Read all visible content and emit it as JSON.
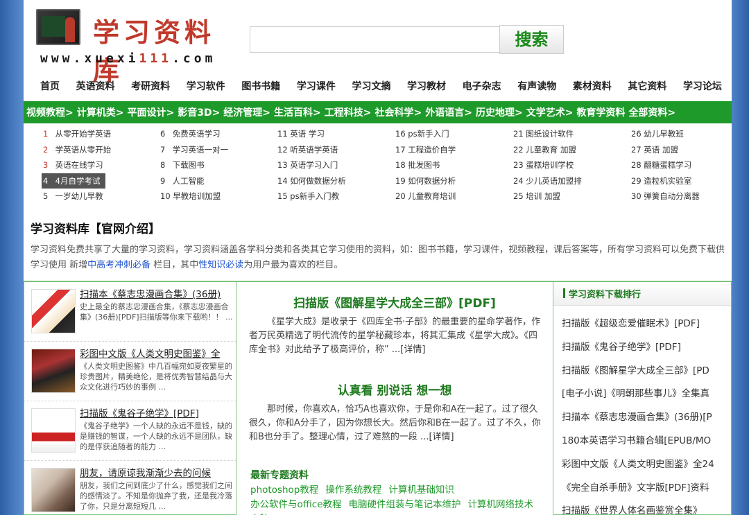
{
  "header": {
    "logo_title": "学习资料库",
    "logo_url_prefix": "www.xuexi",
    "logo_url_number": "111",
    "logo_url_suffix": ".com",
    "search_placeholder": "",
    "search_button": "搜索"
  },
  "nav_main": [
    "首页",
    "英语资料",
    "考研资料",
    "学习软件",
    "图书书籍",
    "学习课件",
    "学习文摘",
    "学习教材",
    "电子杂志",
    "有声读物",
    "素材资料",
    "其它资料",
    "学习论坛"
  ],
  "nav_categories": [
    "视频教程>",
    "计算机类>",
    "平面设计>",
    "影音3D>",
    "经济管理>",
    "生活百科>",
    "工程科技>",
    "社会科学>",
    "外语语言>",
    "历史地理>",
    "文学艺术>",
    "教育学资料",
    "全部资料>"
  ],
  "keywords": [
    [
      {
        "n": "1",
        "t": "从零开始学英语"
      },
      {
        "n": "2",
        "t": "学英语从零开始"
      },
      {
        "n": "3",
        "t": "英语在线学习"
      },
      {
        "n": "4",
        "t": "4月自学考试"
      },
      {
        "n": "5",
        "t": "一岁幼儿早教"
      }
    ],
    [
      {
        "n": "6",
        "t": "免费英语学习"
      },
      {
        "n": "7",
        "t": "学习英语一对一"
      },
      {
        "n": "8",
        "t": "下载图书"
      },
      {
        "n": "9",
        "t": "人工智能"
      },
      {
        "n": "10",
        "t": "早教培训加盟"
      }
    ],
    [
      {
        "n": "11",
        "t": "英语 学习"
      },
      {
        "n": "12",
        "t": "听英语学英语"
      },
      {
        "n": "13",
        "t": "英语学习入门"
      },
      {
        "n": "14",
        "t": "如何做数据分析"
      },
      {
        "n": "15",
        "t": "ps新手入门教"
      }
    ],
    [
      {
        "n": "16",
        "t": "ps新手入门"
      },
      {
        "n": "17",
        "t": "工程造价自学"
      },
      {
        "n": "18",
        "t": "批发图书"
      },
      {
        "n": "19",
        "t": "如何数据分析"
      },
      {
        "n": "20",
        "t": "儿童教育培训"
      }
    ],
    [
      {
        "n": "21",
        "t": "图纸设计软件"
      },
      {
        "n": "22",
        "t": "儿童教育 加盟"
      },
      {
        "n": "23",
        "t": "蛋糕培训学校"
      },
      {
        "n": "24",
        "t": "少儿英语加盟排"
      },
      {
        "n": "25",
        "t": "培训 加盟"
      }
    ],
    [
      {
        "n": "26",
        "t": "幼儿早教班"
      },
      {
        "n": "27",
        "t": "英语 加盟"
      },
      {
        "n": "28",
        "t": "翻糖蛋糕学习"
      },
      {
        "n": "29",
        "t": "造粒机实验室"
      },
      {
        "n": "30",
        "t": "弹簧自动分离器"
      }
    ]
  ],
  "intro": {
    "title": "学习资料库【官网介绍】",
    "text_1": "学习资料免费共享了大量的学习资料，学习资料涵盖各学科分类和各类其它学习使用的资料，如：图书书籍，学习课件，视频教程，课后答案等，所有学习资料可以免费下载供学习使用 新增",
    "link_1": "中高考冲刺必备",
    "text_2": " 栏目，其中",
    "link_2": "性知识必读",
    "text_3": "为用户最为喜欢的栏目。"
  },
  "left_items": [
    {
      "title": "扫描本《蔡志忠漫画合集》(36册)",
      "desc": "史上最全的蔡志忠漫画合集，《蔡志忠漫画合集》(36册)[PDF]扫描版等你来下载哟！！ ..."
    },
    {
      "title": "彩图中文版《人类文明史图鉴》全",
      "desc": "《人类文明史图鉴》中几百幅宛如夏夜繁星的珍贵图片，精美绝伦，是将优秀智慧结晶与大众文化进行巧妙的事例 ..."
    },
    {
      "title": "扫描版《鬼谷子绝学》[PDF]",
      "desc": "《鬼谷子绝学》一个人缺的永远不是钱，缺的是赚钱的智谋，一个人缺的永远不是团队，缺的是俘获追随者的能力 ..."
    },
    {
      "title": "朋友，请原谅我渐渐少去的问候",
      "desc": "朋友，我们之间到底少了什么，感觉我们之间的感情淡了。不知是你抛弃了我，还是我冷落了你，只是分离短短几 ..."
    }
  ],
  "middle": {
    "article_1_title": "扫描版《图解星学大成全三部》[PDF]",
    "article_1_text": "《星学大成》是收录于《四库全书·子部》的最重要的星命学著作，作者万民英精选了明代流传的星学秘藏珍本，将其汇集成《星学大成》。《四库全书》对此给予了极高评价，称”",
    "article_1_more": " ...[详情]",
    "article_2_title": "认真看 别说话 想一想",
    "article_2_text": "那时候，你喜欢A，恰巧A也喜欢你，于是你和A在一起了。过了很久很久，你和A分手了，因为你想长大。然后你和B在一起了。过了不久，你和B也分手了。整理心情，过了难熬的一段",
    "article_2_more": " ...[详情]",
    "topics_title": "最新专题资料",
    "topics": [
      "photoshop教程",
      "操作系统教程",
      "计算机基础知识",
      "办公软件与office教程",
      "电脑硬件组装与笔记本维护",
      "计算机网络技术",
      "电脑"
    ]
  },
  "ranking": {
    "title": "学习资料下载排行",
    "items": [
      "扫描版《超级恋爱催眠术》[PDF]",
      "扫描版《鬼谷子绝学》[PDF]",
      "扫描版《图解星学大成全三部》[PD",
      "[电子小说]《明朝那些事儿》全集真",
      "扫描本《蔡志忠漫画合集》(36册)[P",
      "180本英语学习书籍合辑[EPUB/MO",
      "彩图中文版《人类文明史图鉴》全24",
      "《完全自杀手册》文字版[PDF]资料",
      "扫描版《世界人体名画鉴赏全集》"
    ]
  },
  "colors": {
    "brand_green": "#1e9a2a",
    "logo_red": "#c0392b",
    "link_blue": "#1a4fcf"
  }
}
